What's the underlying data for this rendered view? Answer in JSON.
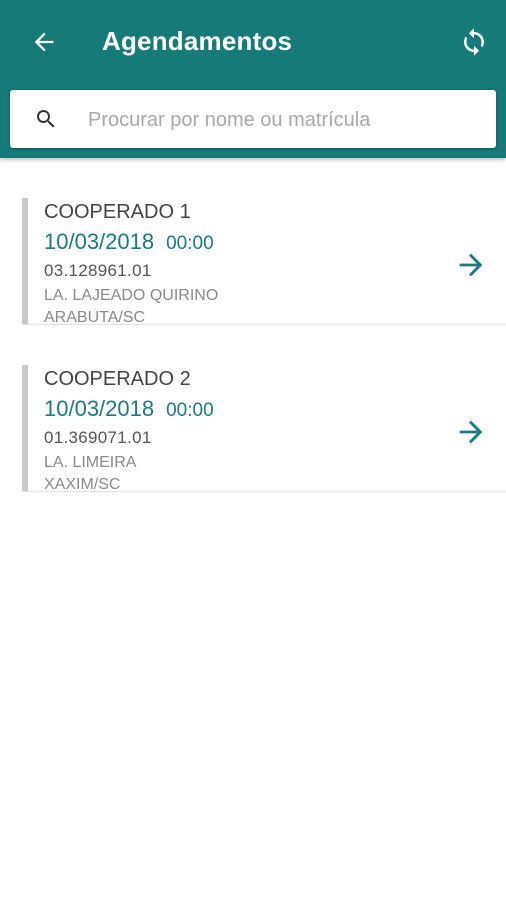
{
  "header": {
    "title": "Agendamentos",
    "back_icon": "arrow-left-icon",
    "sync_icon": "sync-icon",
    "color": "#167a78"
  },
  "search": {
    "placeholder": "Procurar por nome ou matrícula",
    "value": ""
  },
  "appointments": [
    {
      "name": "COOPERADO 1",
      "date": "10/03/2018",
      "time": "00:00",
      "code": "03.128961.01",
      "location": "LA. LAJEADO QUIRINO",
      "city": "ARABUTA/SC"
    },
    {
      "name": "COOPERADO 2",
      "date": "10/03/2018",
      "time": "00:00",
      "code": "01.369071.01",
      "location": "LA. LIMEIRA",
      "city": "XAXIM/SC"
    }
  ],
  "accent_color": "#1b7a82"
}
